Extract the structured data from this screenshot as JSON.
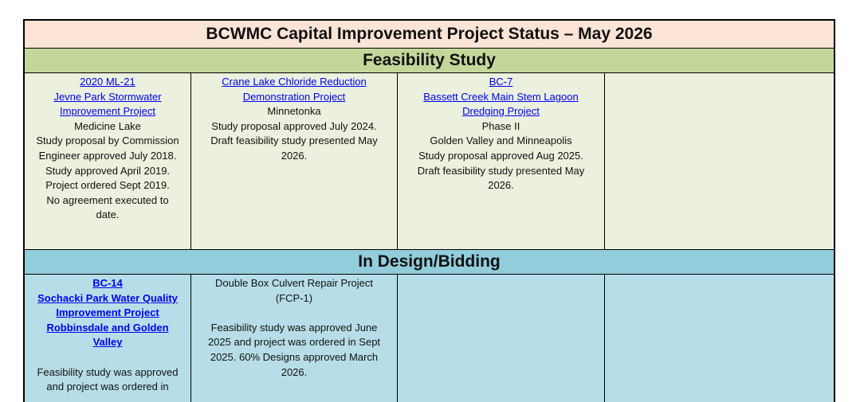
{
  "title": "BCWMC Capital Improvement Project Status – May 2026",
  "feasibility": {
    "heading": "Feasibility Study",
    "cells": [
      {
        "links": [
          "2020 ML-21",
          "Jevne Park Stormwater",
          "Improvement Project"
        ],
        "lines": [
          "Medicine Lake",
          "Study proposal by Commission",
          "Engineer approved July 2018.",
          "Study approved April 2019.",
          "Project ordered Sept 2019.",
          "No agreement executed to",
          "date."
        ]
      },
      {
        "links": [
          "Crane Lake Chloride Reduction",
          "Demonstration Project"
        ],
        "lines": [
          "Minnetonka",
          "Study proposal approved July 2024.",
          "Draft feasibility study presented May",
          "2026."
        ]
      },
      {
        "links": [
          "BC-7",
          "Bassett Creek Main Stem Lagoon",
          "Dredging Project"
        ],
        "lines": [
          "Phase II",
          "Golden Valley and Minneapolis",
          "Study proposal approved Aug 2025.",
          "Draft feasibility study presented May",
          "2026."
        ]
      }
    ]
  },
  "design": {
    "heading": "In Design/Bidding",
    "cells": [
      {
        "links": [
          "BC-14",
          "Sochacki Park Water Quality",
          "Improvement Project",
          "Robbinsdale and Golden",
          "Valley"
        ],
        "lines": [
          "Feasibility study was approved",
          "and project was ordered in"
        ]
      },
      {
        "lines_top": [
          "Double Box Culvert Repair Project",
          "(FCP-1)"
        ],
        "lines": [
          "Feasibility study was approved June",
          "2025 and project was ordered in Sept",
          "2025. 60% Designs approved March",
          "2026."
        ]
      }
    ]
  }
}
